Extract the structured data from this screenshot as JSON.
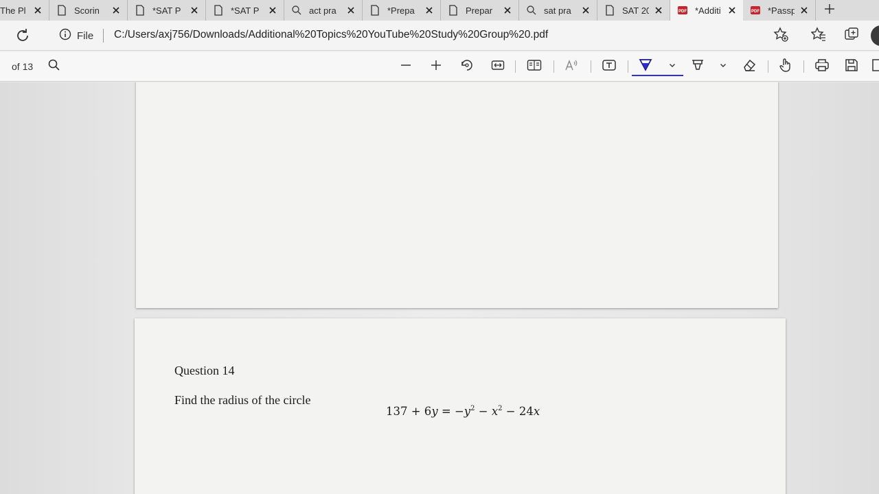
{
  "tabs": [
    {
      "title": "The Pl",
      "icon": "none"
    },
    {
      "title": "Scorin",
      "icon": "page-icon"
    },
    {
      "title": "*SAT P",
      "icon": "page-icon"
    },
    {
      "title": "*SAT P",
      "icon": "page-icon"
    },
    {
      "title": "act pra",
      "icon": "search-icon"
    },
    {
      "title": "*Prepa",
      "icon": "page-icon"
    },
    {
      "title": "Prepar",
      "icon": "page-icon"
    },
    {
      "title": "sat pra",
      "icon": "search-icon"
    },
    {
      "title": "SAT 20",
      "icon": "page-icon"
    },
    {
      "title": "*Additi",
      "icon": "pdf-icon",
      "active": true
    },
    {
      "title": "*Passp",
      "icon": "pdf-icon"
    }
  ],
  "address": {
    "site_label": "File",
    "url": "C:/Users/axj756/Downloads/Additional%20Topics%20YouTube%20Study%20Group%20.pdf"
  },
  "pdf_toolbar": {
    "page_count": "of 13",
    "active_tool": "highlight"
  },
  "document": {
    "question_title": "Question 14",
    "question_text": "Find the radius of the circle",
    "equation": {
      "lhs": "137 + 6",
      "lhs_var": "y",
      "eq": " = −",
      "t1": "y",
      "t2": " − ",
      "t3": "x",
      "t4": " − 24",
      "t5": "x",
      "exp": "2"
    }
  },
  "colors": {
    "accent": "#2f2fd0",
    "pdf_badge": "#c4262e"
  }
}
